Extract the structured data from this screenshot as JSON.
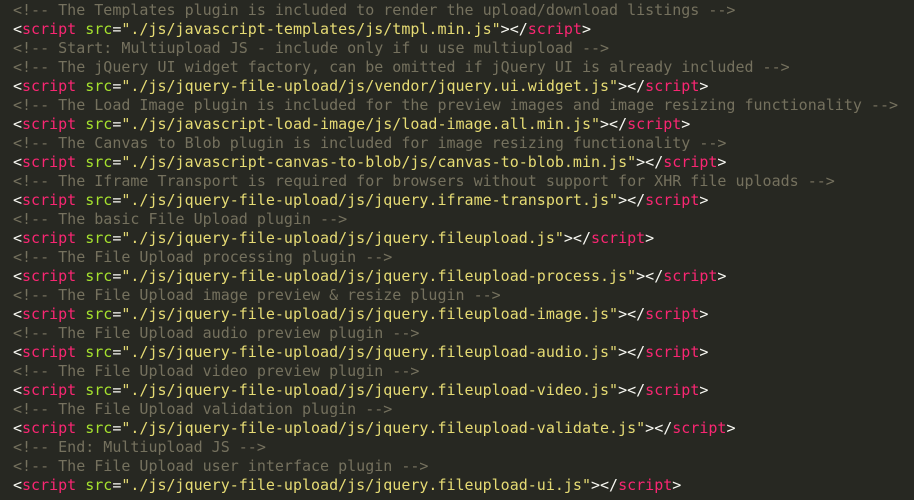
{
  "colors": {
    "background": "#272822",
    "comment": "#75715e",
    "tag": "#f92672",
    "attribute": "#a6e22e",
    "string": "#e6db74",
    "punctuation": "#f8f8f2"
  },
  "editor": {
    "lines": [
      {
        "kind": "comment",
        "text": "<!-- The Templates plugin is included to render the upload/download listings -->"
      },
      {
        "kind": "script",
        "src": "./js/javascript-templates/js/tmpl.min.js"
      },
      {
        "kind": "comment",
        "text": "<!-- Start: Multiupload JS - include only if u use multiupload -->"
      },
      {
        "kind": "comment",
        "text": "<!-- The jQuery UI widget factory, can be omitted if jQuery UI is already included -->"
      },
      {
        "kind": "script",
        "src": "./js/jquery-file-upload/js/vendor/jquery.ui.widget.js"
      },
      {
        "kind": "comment",
        "text": "<!-- The Load Image plugin is included for the preview images and image resizing functionality -->"
      },
      {
        "kind": "script",
        "src": "./js/javascript-load-image/js/load-image.all.min.js"
      },
      {
        "kind": "comment",
        "text": "<!-- The Canvas to Blob plugin is included for image resizing functionality -->"
      },
      {
        "kind": "script",
        "src": "./js/javascript-canvas-to-blob/js/canvas-to-blob.min.js"
      },
      {
        "kind": "comment",
        "text": "<!-- The Iframe Transport is required for browsers without support for XHR file uploads -->"
      },
      {
        "kind": "script",
        "src": "./js/jquery-file-upload/js/jquery.iframe-transport.js"
      },
      {
        "kind": "comment",
        "text": "<!-- The basic File Upload plugin -->"
      },
      {
        "kind": "script",
        "src": "./js/jquery-file-upload/js/jquery.fileupload.js"
      },
      {
        "kind": "comment",
        "text": "<!-- The File Upload processing plugin -->"
      },
      {
        "kind": "script",
        "src": "./js/jquery-file-upload/js/jquery.fileupload-process.js"
      },
      {
        "kind": "comment",
        "text": "<!-- The File Upload image preview & resize plugin -->"
      },
      {
        "kind": "script",
        "src": "./js/jquery-file-upload/js/jquery.fileupload-image.js"
      },
      {
        "kind": "comment",
        "text": "<!-- The File Upload audio preview plugin -->"
      },
      {
        "kind": "script",
        "src": "./js/jquery-file-upload/js/jquery.fileupload-audio.js"
      },
      {
        "kind": "comment",
        "text": "<!-- The File Upload video preview plugin -->"
      },
      {
        "kind": "script",
        "src": "./js/jquery-file-upload/js/jquery.fileupload-video.js"
      },
      {
        "kind": "comment",
        "text": "<!-- The File Upload validation plugin -->"
      },
      {
        "kind": "script",
        "src": "./js/jquery-file-upload/js/jquery.fileupload-validate.js"
      },
      {
        "kind": "comment",
        "text": "<!-- End: Multiupload JS -->"
      },
      {
        "kind": "comment",
        "text": "<!-- The File Upload user interface plugin -->"
      },
      {
        "kind": "script",
        "src": "./js/jquery-file-upload/js/jquery.fileupload-ui.js"
      }
    ],
    "tokens": {
      "open_bracket": "<",
      "tag_name": "script",
      "attr_prefix": " ",
      "attr_name": "src",
      "equals": "=",
      "quote": "\"",
      "close_open_tag": ">",
      "end_tag_open": "</",
      "close_bracket": ">"
    }
  }
}
